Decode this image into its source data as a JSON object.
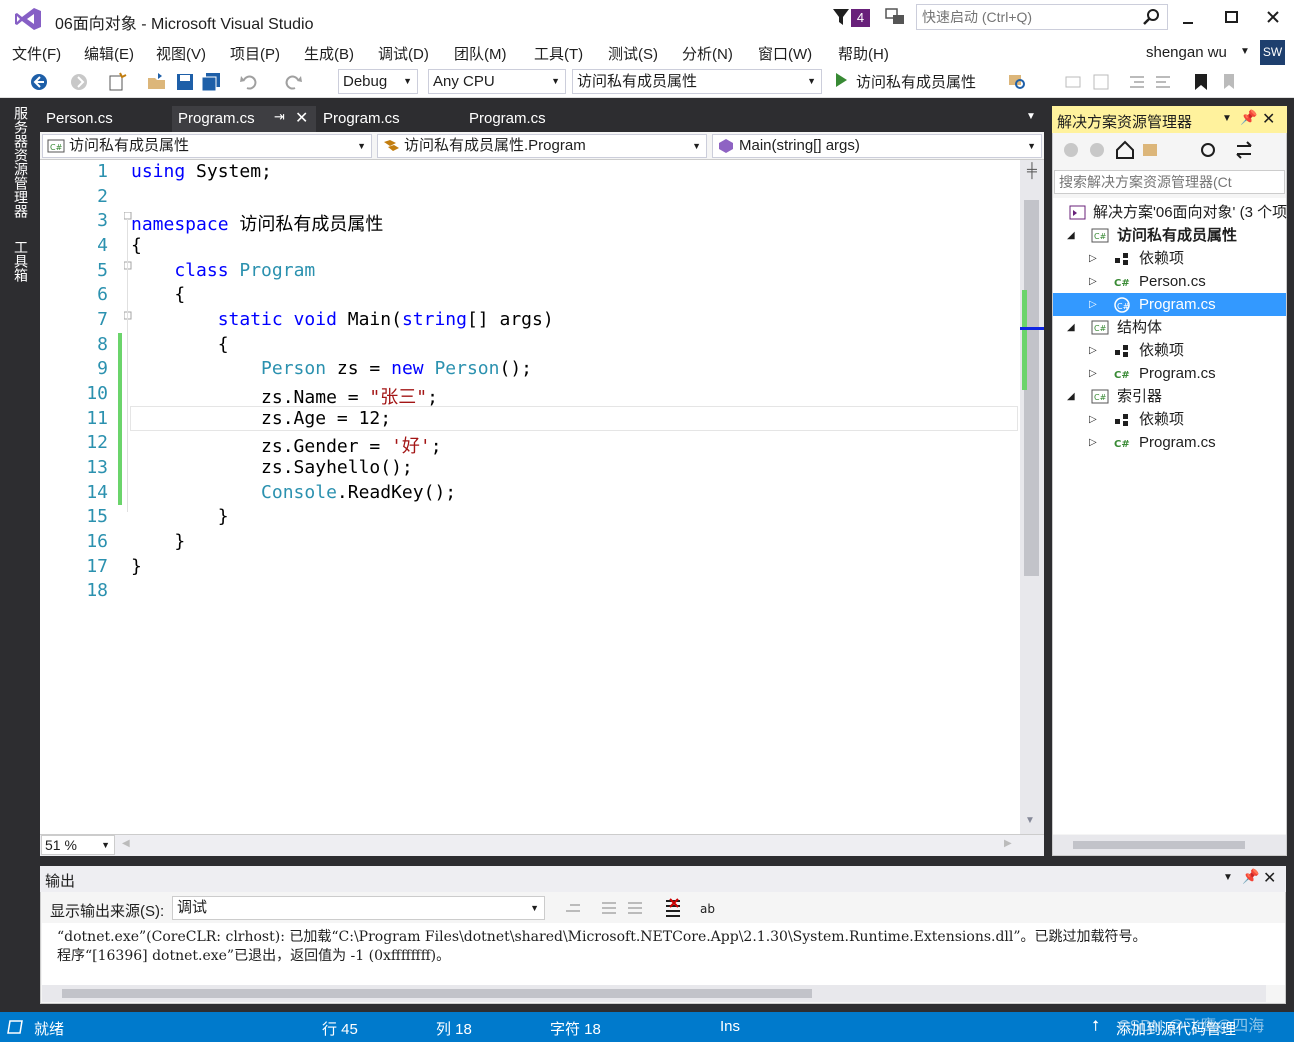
{
  "window": {
    "title": "06面向对象 - Microsoft Visual Studio",
    "notification_count": "4",
    "quick_launch_placeholder": "快速启动 (Ctrl+Q)"
  },
  "menu": [
    "文件(F)",
    "编辑(E)",
    "视图(V)",
    "项目(P)",
    "生成(B)",
    "调试(D)",
    "团队(M)",
    "工具(T)",
    "测试(S)",
    "分析(N)",
    "窗口(W)",
    "帮助(H)"
  ],
  "user": {
    "name": "shengan wu",
    "initials": "SW"
  },
  "toolbar": {
    "config": "Debug",
    "platform": "Any CPU",
    "startup_project": "访问私有成员属性",
    "run_label": "访问私有成员属性"
  },
  "left_tabs": [
    "服务器资源管理器",
    "工具箱"
  ],
  "editor_tabs": [
    {
      "label": "Person.cs"
    },
    {
      "label": "Program.cs"
    },
    {
      "label": "Program.cs"
    },
    {
      "label": "Program.cs"
    }
  ],
  "nav": {
    "project": "访问私有成员属性",
    "type": "访问私有成员属性.Program",
    "member": "Main(string[] args)"
  },
  "code_lines": [
    "1",
    "2",
    "3",
    "4",
    "5",
    "6",
    "7",
    "8",
    "9",
    "10",
    "11",
    "12",
    "13",
    "14",
    "15",
    "16",
    "17",
    "18"
  ],
  "code": {
    "l1_kw": "using",
    "l1_rest": " System;",
    "l3_kw": "namespace",
    "l3_rest": " 访问私有成员属性",
    "l4": "{",
    "l5_kw": "    class",
    "l5_ty": " Program",
    "l6": "    {",
    "l7_kw1": "        static",
    "l7_kw2": " void",
    "l7_mid": " Main(",
    "l7_kw3": "string",
    "l7_rest": "[] args)",
    "l8": "        {",
    "l9_ty1": "            Person",
    "l9_mid": " zs = ",
    "l9_kw": "new",
    "l9_ty2": " Person",
    "l9_rest": "();",
    "l10_a": "            zs.Name = ",
    "l10_str": "\"张三\"",
    "l10_b": ";",
    "l11": "            zs.Age = 12;",
    "l12_a": "            zs.Gender = ",
    "l12_str": "'好'",
    "l12_b": ";",
    "l13": "            zs.Sayhello();",
    "l14_ty": "            Console",
    "l14_rest": ".ReadKey();",
    "l15": "        }",
    "l16": "    }",
    "l17": "}"
  },
  "zoom": "51 %",
  "solution_explorer": {
    "title": "解决方案资源管理器",
    "search_placeholder": "搜索解决方案资源管理器(Ct",
    "nodes": [
      {
        "label": "解决方案'06面向对象' (3 个项"
      },
      {
        "label": "访问私有成员属性"
      },
      {
        "label": "依赖项"
      },
      {
        "label": "Person.cs"
      },
      {
        "label": "Program.cs"
      },
      {
        "label": "结构体"
      },
      {
        "label": "依赖项"
      },
      {
        "label": "Program.cs"
      },
      {
        "label": "索引器"
      },
      {
        "label": "依赖项"
      },
      {
        "label": "Program.cs"
      }
    ]
  },
  "output": {
    "title": "输出",
    "source_label": "显示输出来源(S):",
    "source_value": "调试",
    "lines": [
      "“dotnet.exe”(CoreCLR: clrhost): 已加载“C:\\Program Files\\dotnet\\shared\\Microsoft.NETCore.App\\2.1.30\\System.Runtime.Extensions.dll”。已跳过加载符号。",
      "程序“[16396] dotnet.exe”已退出，返回值为 -1 (0xffffffff)。"
    ]
  },
  "status": {
    "ready": "就绪",
    "line": "行 45",
    "col": "列 18",
    "char": "字符 18",
    "mode": "Ins",
    "source_control": "添加到源代码管理",
    "watermark": "CSDN @飞鹰@四海"
  },
  "colors": {
    "accent": "#007acc",
    "selection": "#3399ff",
    "panel_header_active": "#fff29d",
    "vs_purple": "#68217a"
  }
}
